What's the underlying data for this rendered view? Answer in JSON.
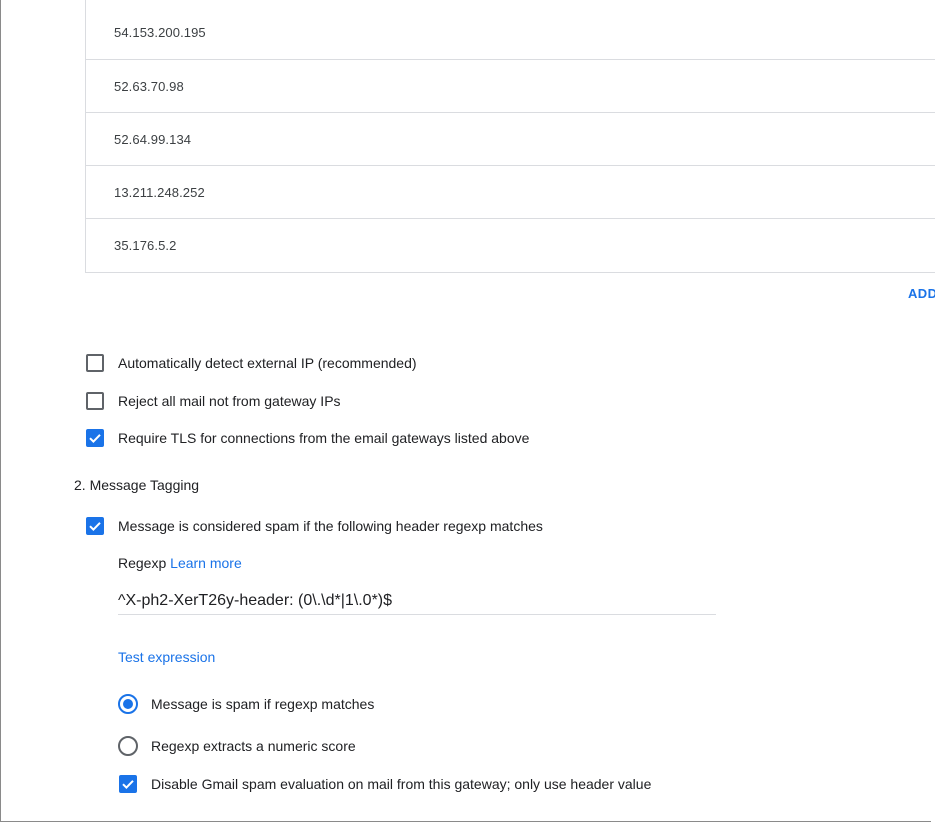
{
  "gateway_ips": {
    "rows": [
      "54.153.200.195",
      "52.63.70.98",
      "52.64.99.134",
      "13.211.248.252",
      "35.176.5.2"
    ],
    "add_label": "ADD"
  },
  "options": {
    "auto_detect": {
      "label": "Automatically detect external IP (recommended)",
      "checked": false
    },
    "reject_non_gateway": {
      "label": "Reject all mail not from gateway IPs",
      "checked": false
    },
    "require_tls": {
      "label": "Require TLS for connections from the email gateways listed above",
      "checked": true
    }
  },
  "message_tagging": {
    "title": "2. Message Tagging",
    "spam_header": {
      "label": "Message is considered spam if the following header regexp matches",
      "checked": true
    },
    "regexp_label": "Regexp",
    "learn_more": "Learn more",
    "regexp_value": "^X-ph2-XerT26y-header: (0\\.\\d*|1\\.0*)$",
    "test_expression": "Test expression",
    "radio_spam_if_match": {
      "label": "Message is spam if regexp matches",
      "selected": true
    },
    "radio_numeric_score": {
      "label": "Regexp extracts a numeric score",
      "selected": false
    },
    "disable_gmail_eval": {
      "label": "Disable Gmail spam evaluation on mail from this gateway; only use header value",
      "checked": true
    }
  },
  "colors": {
    "accent": "#1a73e8",
    "border": "#dadce0",
    "text": "#202124"
  },
  "icons": {
    "checkbox_checked": "checkmark-icon"
  }
}
